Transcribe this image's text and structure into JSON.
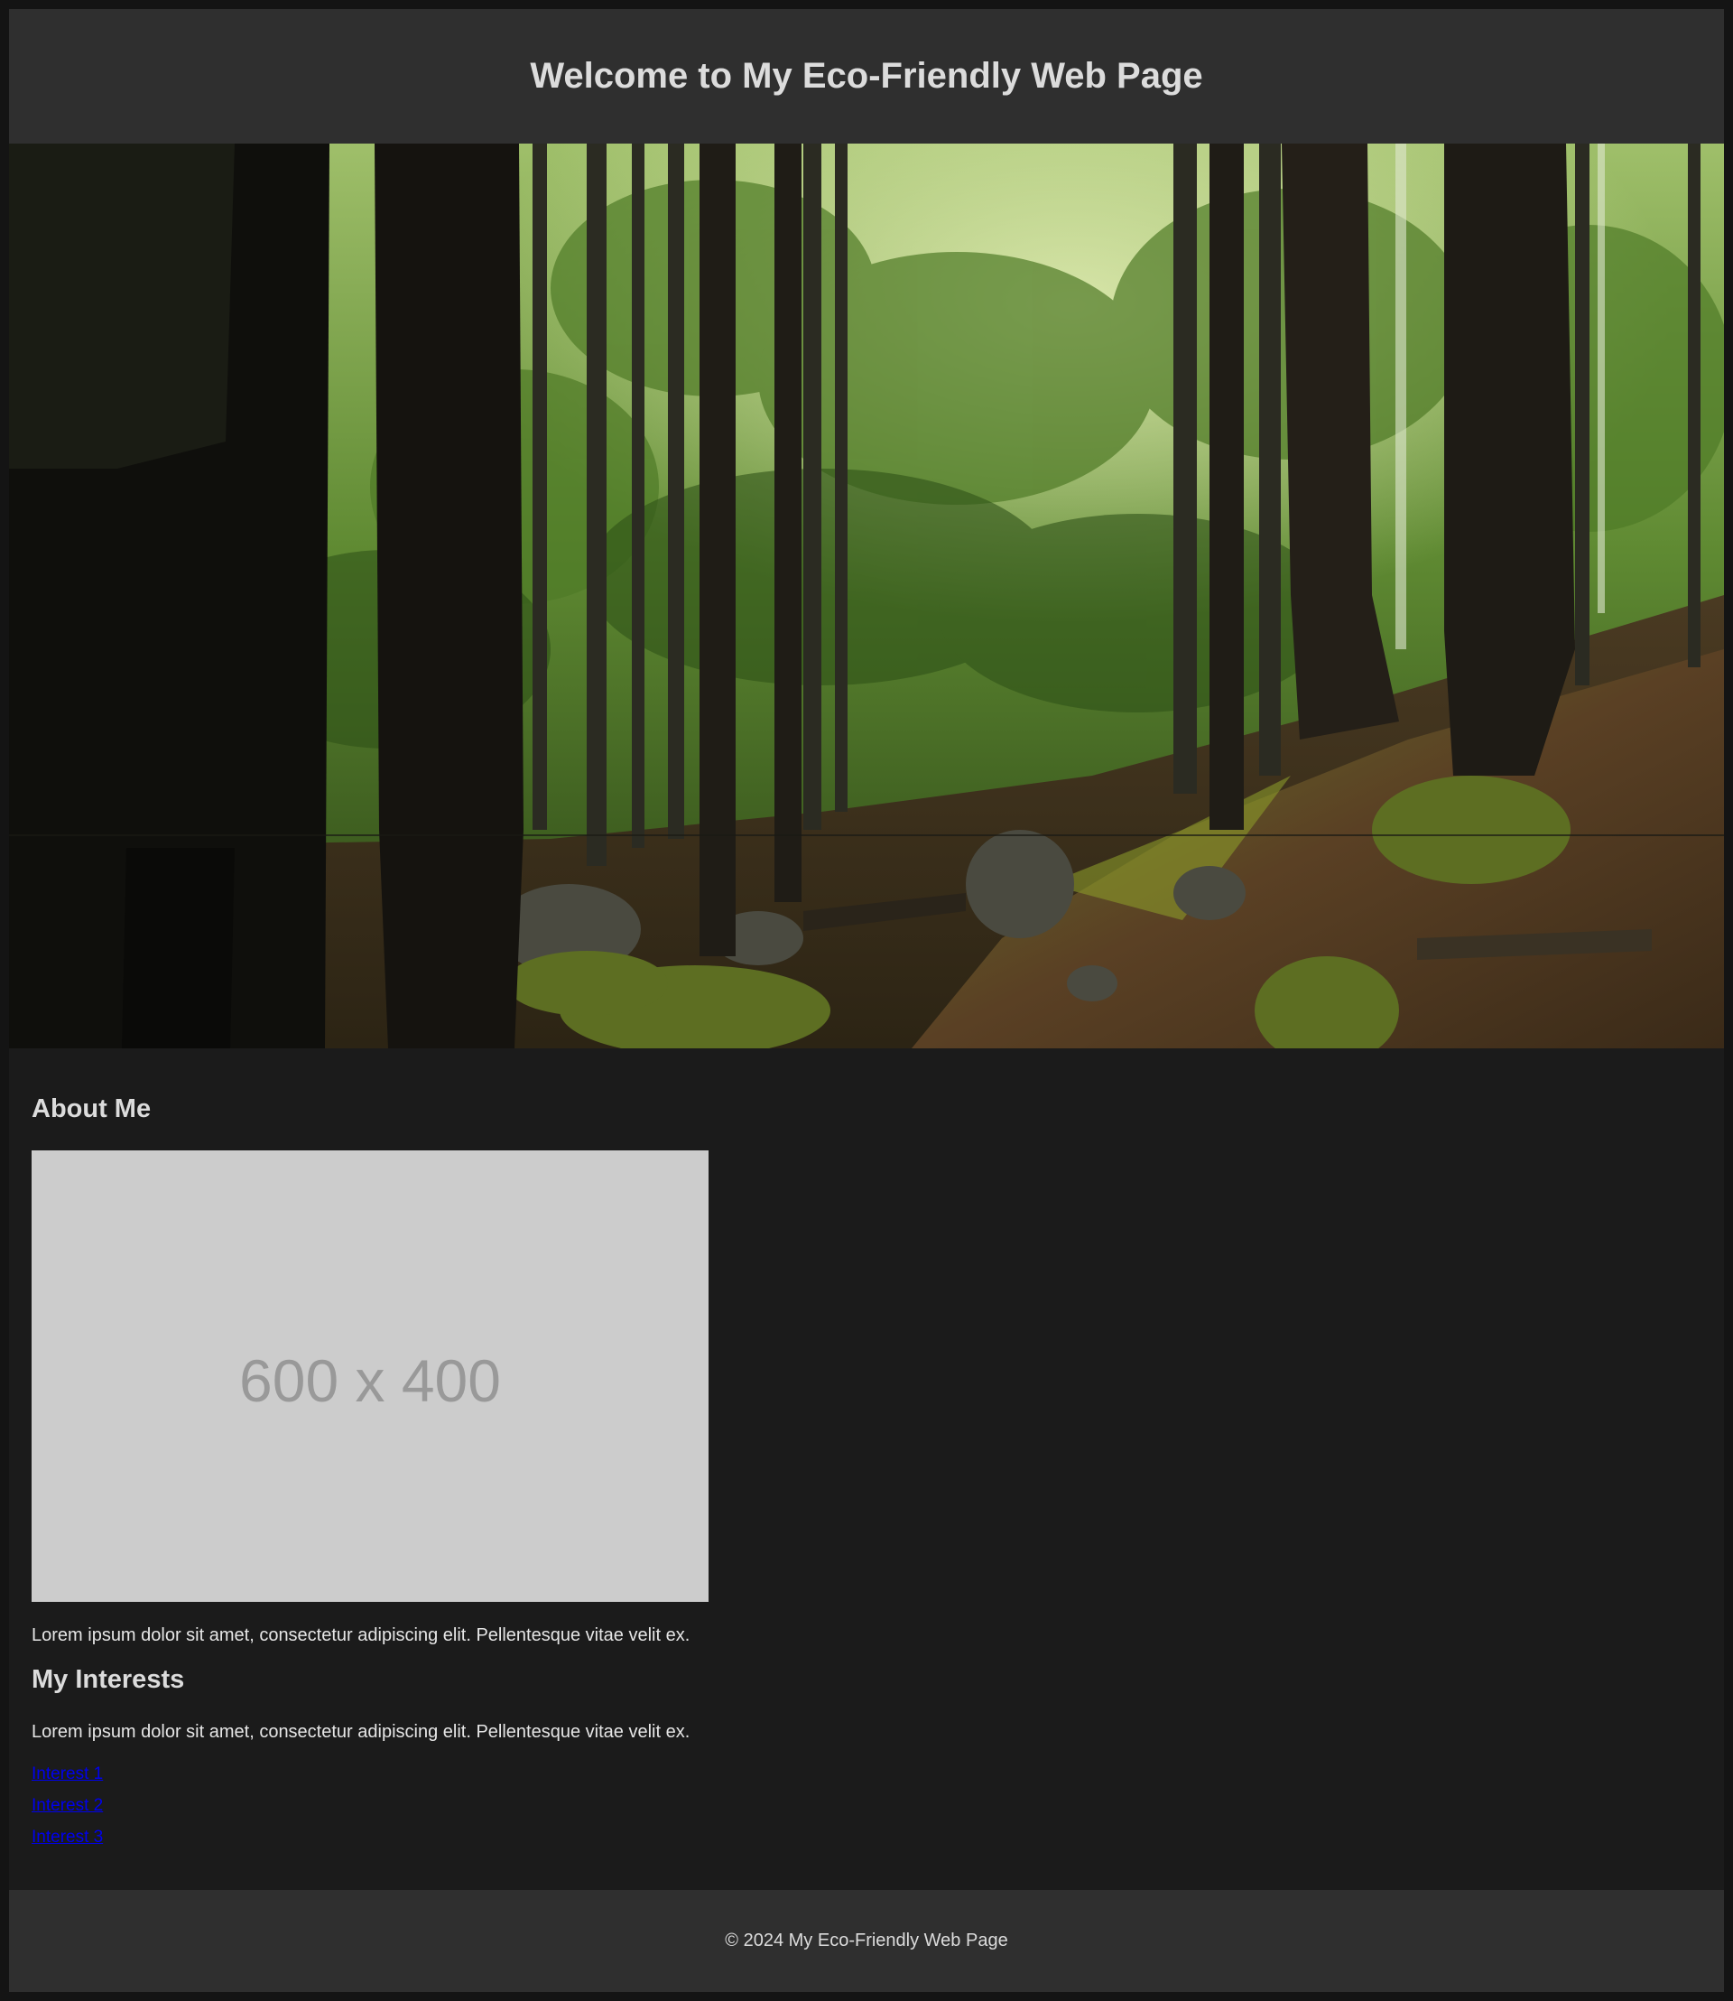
{
  "header": {
    "title": "Welcome to My Eco-Friendly Web Page"
  },
  "hero": {
    "description": "forest-photo"
  },
  "about": {
    "heading": "About Me",
    "image_placeholder": "600 x 400",
    "text": "Lorem ipsum dolor sit amet, consectetur adipiscing elit. Pellentesque vitae velit ex."
  },
  "interests": {
    "heading": "My Interests",
    "text": "Lorem ipsum dolor sit amet, consectetur adipiscing elit. Pellentesque vitae velit ex.",
    "links": [
      {
        "label": "Interest 1"
      },
      {
        "label": "Interest 2"
      },
      {
        "label": "Interest 3"
      }
    ]
  },
  "footer": {
    "text": "© 2024 My Eco-Friendly Web Page"
  },
  "colors": {
    "page_background": "#1b1b1b",
    "header_background": "#2f2f2f",
    "text": "#dcdcdc",
    "link": "#0000ee",
    "placeholder_bg": "#cccccc",
    "placeholder_text": "#999999"
  }
}
